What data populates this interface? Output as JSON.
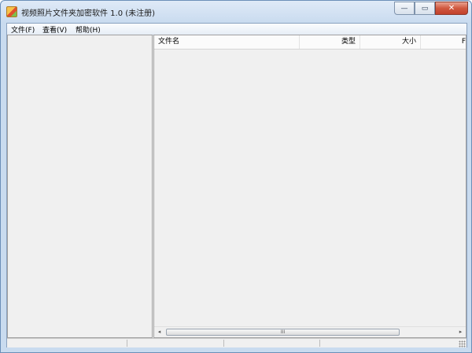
{
  "window": {
    "title": "视频照片文件夹加密软件 1.0 (未注册)",
    "min_symbol": "—",
    "max_symbol": "▭",
    "close_symbol": "✕"
  },
  "menu": {
    "items": [
      "文件(F)",
      "查看(V)",
      "帮助(H)"
    ]
  },
  "list": {
    "columns": [
      "文件名",
      "类型",
      "大小",
      "F"
    ]
  },
  "scrollbar": {
    "left_arrow": "◂",
    "right_arrow": "▸",
    "thumb_grip": "III"
  },
  "icons": {
    "app": "app-icon",
    "minimize": "minimize-icon",
    "maximize": "maximize-icon",
    "close": "close-icon"
  }
}
